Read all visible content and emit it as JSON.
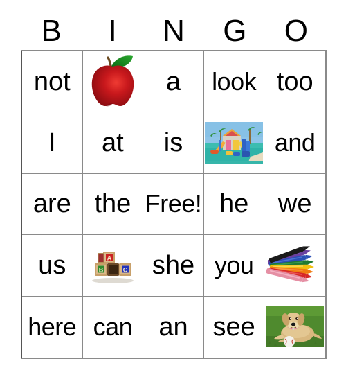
{
  "card": {
    "type": "bingo-card",
    "header_letters": [
      "B",
      "I",
      "N",
      "G",
      "O"
    ],
    "columns": 5,
    "rows": 5,
    "grid_line_color": "#8a8a8a",
    "background_color": "#ffffff",
    "text_color": "#000000",
    "cells": [
      {
        "row": 1,
        "col": 1,
        "kind": "text",
        "text": "not"
      },
      {
        "row": 1,
        "col": 2,
        "kind": "image",
        "image": "apple-icon",
        "alt": "red apple with green leaf"
      },
      {
        "row": 1,
        "col": 3,
        "kind": "text",
        "text": "a"
      },
      {
        "row": 1,
        "col": 4,
        "kind": "text",
        "text": "look"
      },
      {
        "row": 1,
        "col": 5,
        "kind": "text",
        "text": "too"
      },
      {
        "row": 2,
        "col": 1,
        "kind": "text",
        "text": "I"
      },
      {
        "row": 2,
        "col": 2,
        "kind": "text",
        "text": "at"
      },
      {
        "row": 2,
        "col": 3,
        "kind": "text",
        "text": "is"
      },
      {
        "row": 2,
        "col": 4,
        "kind": "image",
        "image": "playground-photo",
        "alt": "colorful water playground"
      },
      {
        "row": 2,
        "col": 5,
        "kind": "text",
        "text": "and"
      },
      {
        "row": 3,
        "col": 1,
        "kind": "text",
        "text": "are"
      },
      {
        "row": 3,
        "col": 2,
        "kind": "text",
        "text": "the"
      },
      {
        "row": 3,
        "col": 3,
        "kind": "text",
        "text": "Free!"
      },
      {
        "row": 3,
        "col": 4,
        "kind": "text",
        "text": "he"
      },
      {
        "row": 3,
        "col": 5,
        "kind": "text",
        "text": "we"
      },
      {
        "row": 4,
        "col": 1,
        "kind": "text",
        "text": "us"
      },
      {
        "row": 4,
        "col": 2,
        "kind": "image",
        "image": "abc-blocks-photo",
        "alt": "wooden ABC alphabet blocks"
      },
      {
        "row": 4,
        "col": 3,
        "kind": "text",
        "text": "she"
      },
      {
        "row": 4,
        "col": 4,
        "kind": "text",
        "text": "you"
      },
      {
        "row": 4,
        "col": 5,
        "kind": "image",
        "image": "crayons-photo",
        "alt": "fan of colored crayons"
      },
      {
        "row": 5,
        "col": 1,
        "kind": "text",
        "text": "here"
      },
      {
        "row": 5,
        "col": 2,
        "kind": "text",
        "text": "can"
      },
      {
        "row": 5,
        "col": 3,
        "kind": "text",
        "text": "an"
      },
      {
        "row": 5,
        "col": 4,
        "kind": "text",
        "text": "see"
      },
      {
        "row": 5,
        "col": 5,
        "kind": "image",
        "image": "puppy-photo",
        "alt": "yellow labrador puppy on grass with baseball"
      }
    ],
    "image_colors": {
      "apple_body": "#c0161b",
      "apple_highlight": "#e8302c",
      "apple_leaf": "#1d8a22",
      "apple_stem": "#6b4a20",
      "playground_sky": "#7fb6e0",
      "playground_ground": "#2fb3a8",
      "blocks_wood": "#d9b889",
      "blocks_letter_a": "#cc2222",
      "blocks_letter_b": "#2e8b2e",
      "blocks_letter_c": "#2233bb",
      "crayon_pink": "#e58fa4",
      "crayon_red": "#d62828",
      "crayon_orange": "#f07c12",
      "crayon_yellow": "#f2c00e",
      "crayon_green": "#1f7a33",
      "crayon_blue": "#2a4fb5",
      "crayon_purple": "#6b3fa0",
      "crayon_black": "#1a1a1a",
      "puppy_coat": "#d9b87f",
      "puppy_grass": "#4f8a2e",
      "ball_white": "#f2f2ee"
    }
  }
}
